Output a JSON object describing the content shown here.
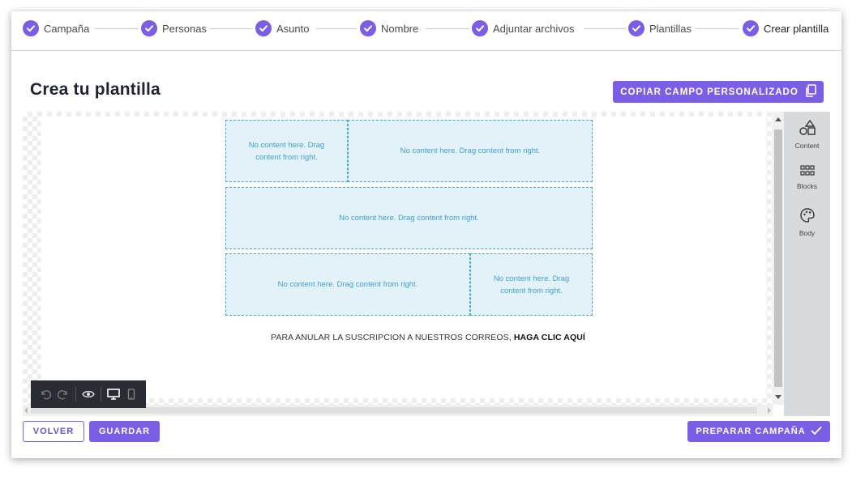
{
  "stepper": {
    "steps": [
      {
        "label": "Campaña"
      },
      {
        "label": "Personas"
      },
      {
        "label": "Asunto"
      },
      {
        "label": "Nombre"
      },
      {
        "label": "Adjuntar archivos"
      },
      {
        "label": "Plantillas"
      },
      {
        "label": "Crear plantilla"
      }
    ]
  },
  "page": {
    "title": "Crea tu plantilla",
    "copy_button": "COPIAR CAMPO PERSONALIZADO"
  },
  "editor": {
    "placeholder": "No content here. Drag content from right.",
    "unsubscribe_text": "PARA ANULAR LA SUSCRIPCION A NUESTROS CORREOS,",
    "unsubscribe_link": "HAGA CLIC AQUÍ",
    "side_panel": [
      {
        "label": "Content",
        "icon": "shapes-icon"
      },
      {
        "label": "Blocks",
        "icon": "grid-icon"
      },
      {
        "label": "Body",
        "icon": "palette-icon"
      }
    ],
    "toolbar": {
      "icons": [
        "undo-icon",
        "redo-icon",
        "eye-icon",
        "desktop-icon",
        "mobile-icon"
      ]
    }
  },
  "footer": {
    "back_button": "VOLVER",
    "save_button": "GUARDAR",
    "prepare_button": "PREPARAR CAMPAÑA"
  },
  "colors": {
    "accent": "#7a5ee6",
    "dropzone_bg": "#e3f2f9",
    "dropzone_border": "#3fa9d6",
    "panel_bg": "#d9dadb",
    "toolbar_bg": "#292c33"
  }
}
